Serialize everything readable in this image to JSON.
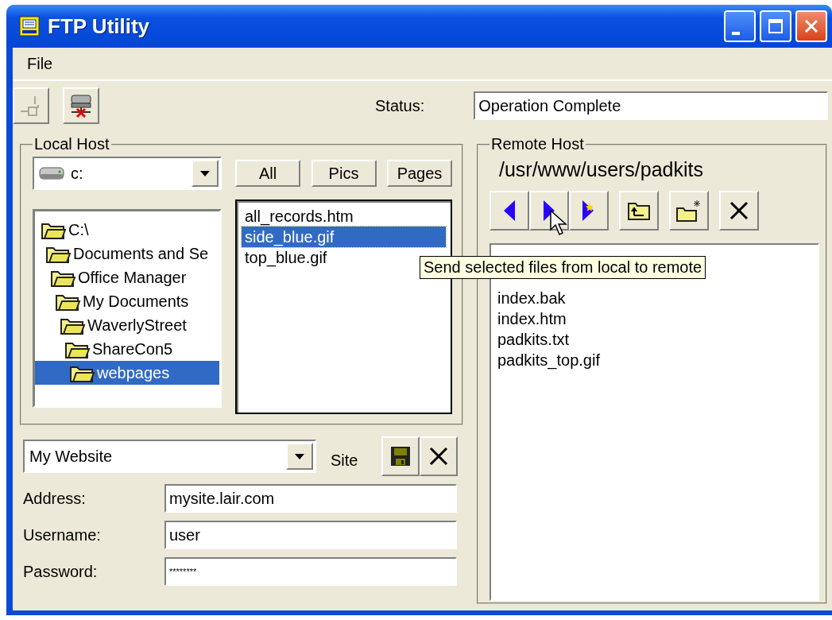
{
  "window": {
    "title": "FTP Utility"
  },
  "menu": [
    {
      "label": "File"
    }
  ],
  "toolbar": [
    {
      "kind": "connect",
      "disabled": true
    },
    {
      "kind": "disconnect",
      "disabled": false
    }
  ],
  "status": {
    "label": "Status:",
    "value": "Operation Complete"
  },
  "local_host": {
    "title": "Local Host",
    "drive": "c:",
    "filters": [
      {
        "label": "All"
      },
      {
        "label": "Pics"
      },
      {
        "label": "Pages"
      }
    ],
    "tree": [
      {
        "label": "C:\\",
        "selected": false,
        "children": [
          {
            "label": "Documents and Se",
            "selected": false,
            "children": [
              {
                "label": "Office Manager",
                "selected": false,
                "children": [
                  {
                    "label": "My Documents",
                    "selected": false,
                    "children": [
                      {
                        "label": "WaverlyStreet",
                        "selected": false,
                        "children": [
                          {
                            "label": "ShareCon5",
                            "selected": false,
                            "children": [
                              {
                                "label": "webpages",
                                "selected": true
                              }
                            ]
                          }
                        ]
                      }
                    ]
                  }
                ]
              }
            ]
          }
        ]
      }
    ],
    "files": [
      {
        "name": "all_records.htm",
        "selected": false
      },
      {
        "name": "side_blue.gif",
        "selected": true
      },
      {
        "name": "top_blue.gif",
        "selected": false
      }
    ]
  },
  "site": {
    "name": "My Website",
    "label": "Site",
    "buttons": [
      {
        "kind": "save"
      },
      {
        "kind": "delete"
      }
    ],
    "fields": [
      {
        "label": "Address:",
        "value": "mysite.lair.com"
      },
      {
        "label": "Username:",
        "value": "user"
      },
      {
        "label": "Password:",
        "value": "********",
        "kind": "password"
      }
    ]
  },
  "remote_host": {
    "title": "Remote Host",
    "path": "/usr/www/users/padkits",
    "buttons": [
      {
        "kind": "left"
      },
      {
        "kind": "right"
      },
      {
        "kind": "right-star"
      },
      {
        "kind": "folder-up"
      },
      {
        "kind": "new-folder"
      },
      {
        "kind": "delete"
      }
    ],
    "files": [
      {
        "name": "index.bak",
        "selected": false
      },
      {
        "name": "index.htm",
        "selected": false
      },
      {
        "name": "padkits.txt",
        "selected": false
      },
      {
        "name": "padkits_top.gif",
        "selected": false
      }
    ]
  },
  "tooltip": {
    "text": "Send selected files from local to remote"
  }
}
